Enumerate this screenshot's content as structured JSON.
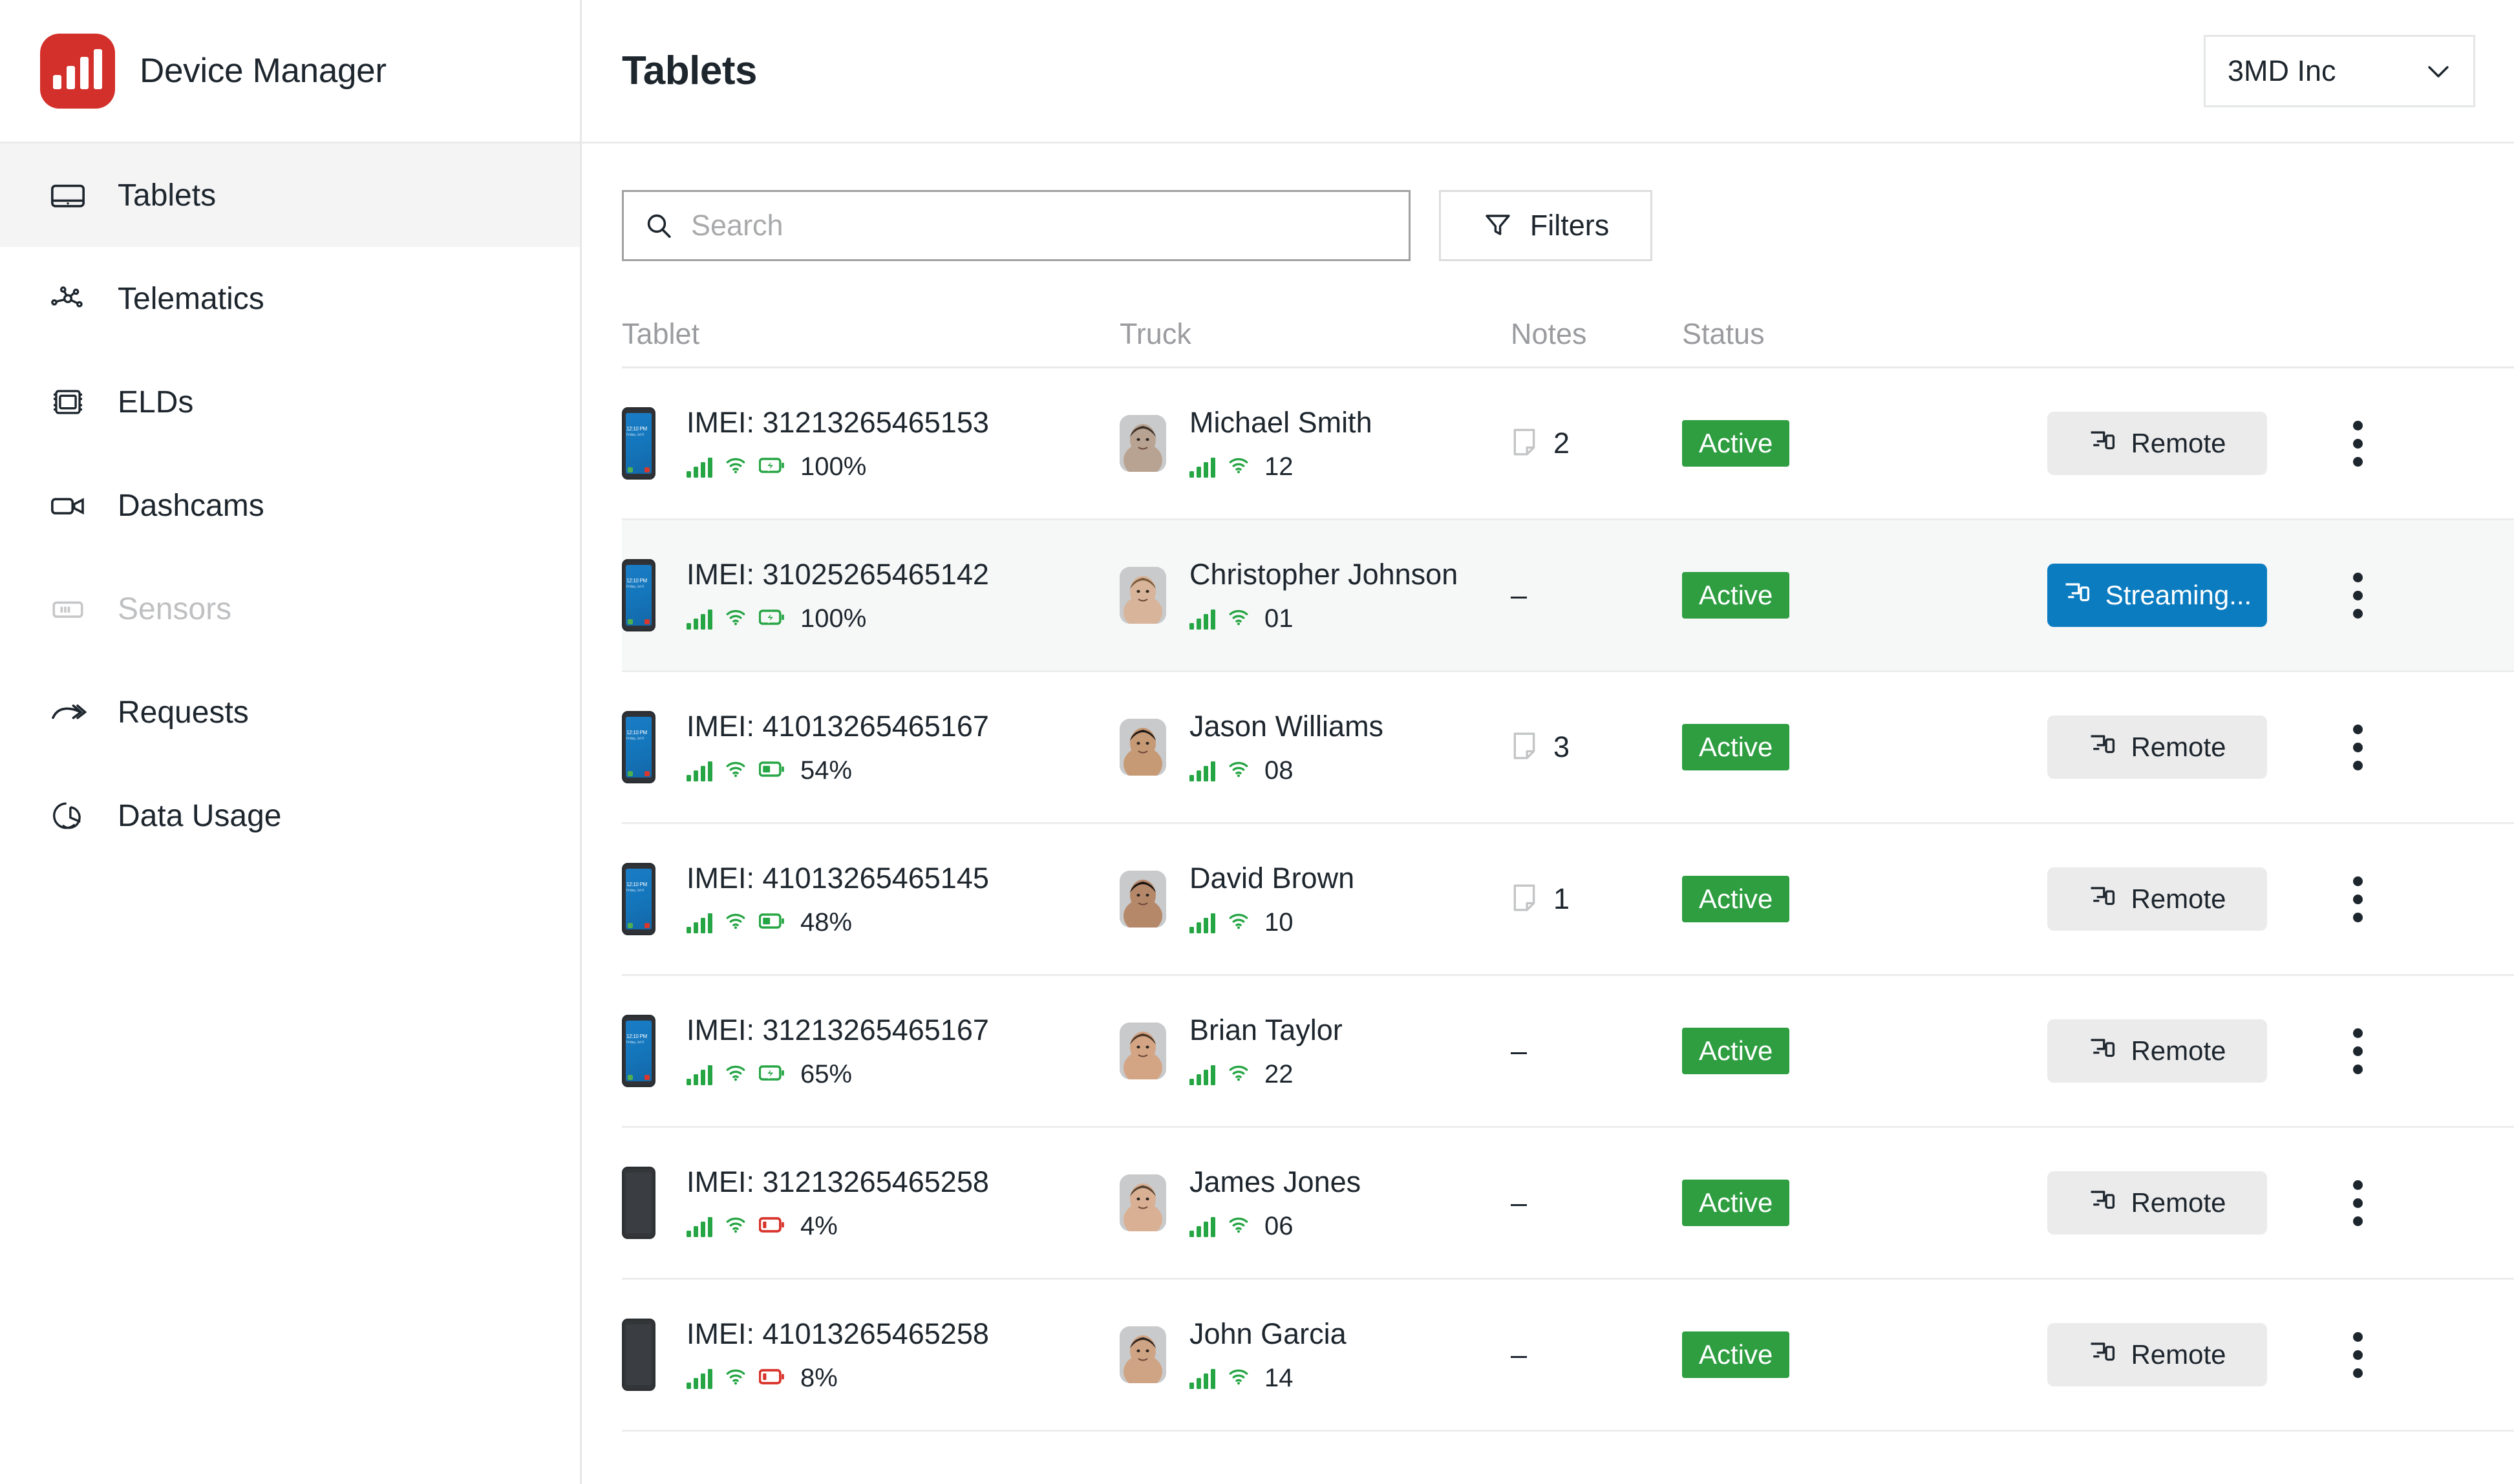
{
  "brand": {
    "name": "Device Manager",
    "logo_icon": "bar-chart-logo-icon",
    "logo_color": "#d32f2b"
  },
  "sidebar": {
    "items": [
      {
        "label": "Tablets",
        "icon": "tablet-icon",
        "active": true,
        "disabled": false
      },
      {
        "label": "Telematics",
        "icon": "telematics-icon",
        "active": false,
        "disabled": false
      },
      {
        "label": "ELDs",
        "icon": "eld-icon",
        "active": false,
        "disabled": false
      },
      {
        "label": "Dashcams",
        "icon": "dashcam-icon",
        "active": false,
        "disabled": false
      },
      {
        "label": "Sensors",
        "icon": "sensor-icon",
        "active": false,
        "disabled": true
      },
      {
        "label": "Requests",
        "icon": "requests-icon",
        "active": false,
        "disabled": false
      },
      {
        "label": "Data Usage",
        "icon": "data-usage-icon",
        "active": false,
        "disabled": false
      }
    ]
  },
  "header": {
    "title": "Tablets",
    "org_selector": {
      "value": "3MD Inc",
      "chevron_icon": "chevron-down-icon"
    }
  },
  "toolbar": {
    "search": {
      "placeholder": "Search",
      "value": "",
      "icon": "search-icon"
    },
    "filters": {
      "label": "Filters",
      "icon": "funnel-icon"
    }
  },
  "table": {
    "columns": [
      "Tablet",
      "Truck",
      "Notes",
      "Status"
    ],
    "rows": [
      {
        "imei": "IMEI: 31213265465153",
        "device_state": "on",
        "battery": "100%",
        "battery_icon": "battery-charging-icon",
        "battery_color": "#26a544",
        "driver": "Michael Smith",
        "truck_number": "12",
        "notes": "2",
        "has_notes": true,
        "status": "Active",
        "action": {
          "label": "Remote",
          "icon": "remote-screen-icon",
          "style": "default"
        },
        "highlight": false,
        "avatar_tone": "#b8a392",
        "avatar_hair": "#3b2f28"
      },
      {
        "imei": "IMEI: 31025265465142",
        "device_state": "on",
        "battery": "100%",
        "battery_icon": "battery-charging-icon",
        "battery_color": "#26a544",
        "driver": "Christopher Johnson",
        "truck_number": "01",
        "notes": "–",
        "has_notes": false,
        "status": "Active",
        "action": {
          "label": "Streaming...",
          "icon": "remote-screen-icon",
          "style": "streaming"
        },
        "highlight": true,
        "avatar_tone": "#d7b49a",
        "avatar_hair": "#7a5a3c"
      },
      {
        "imei": "IMEI: 41013265465167",
        "device_state": "on",
        "battery": "54%",
        "battery_icon": "battery-half-icon",
        "battery_color": "#26a544",
        "driver": "Jason Williams",
        "truck_number": "08",
        "notes": "3",
        "has_notes": true,
        "status": "Active",
        "action": {
          "label": "Remote",
          "icon": "remote-screen-icon",
          "style": "default"
        },
        "highlight": false,
        "avatar_tone": "#c79a76",
        "avatar_hair": "#221a15"
      },
      {
        "imei": "IMEI: 41013265465145",
        "device_state": "on",
        "battery": "48%",
        "battery_icon": "battery-half-icon",
        "battery_color": "#26a544",
        "driver": "David Brown",
        "truck_number": "10",
        "notes": "1",
        "has_notes": true,
        "status": "Active",
        "action": {
          "label": "Remote",
          "icon": "remote-screen-icon",
          "style": "default"
        },
        "highlight": false,
        "avatar_tone": "#b5886a",
        "avatar_hair": "#1b1512"
      },
      {
        "imei": "IMEI: 31213265465167",
        "device_state": "on",
        "battery": "65%",
        "battery_icon": "battery-charging-icon",
        "battery_color": "#26a544",
        "driver": "Brian Taylor",
        "truck_number": "22",
        "notes": "–",
        "has_notes": false,
        "status": "Active",
        "action": {
          "label": "Remote",
          "icon": "remote-screen-icon",
          "style": "default"
        },
        "highlight": false,
        "avatar_tone": "#d3a585",
        "avatar_hair": "#4a3526"
      },
      {
        "imei": "IMEI: 31213265465258",
        "device_state": "off",
        "battery": "4%",
        "battery_icon": "battery-low-icon",
        "battery_color": "#d8322a",
        "driver": "James Jones",
        "truck_number": "06",
        "notes": "–",
        "has_notes": false,
        "status": "Active",
        "action": {
          "label": "Remote",
          "icon": "remote-screen-icon",
          "style": "default"
        },
        "highlight": false,
        "avatar_tone": "#d9b094",
        "avatar_hair": "#53402f"
      },
      {
        "imei": "IMEI: 41013265465258",
        "device_state": "off",
        "battery": "8%",
        "battery_icon": "battery-low-icon",
        "battery_color": "#d8322a",
        "driver": "John Garcia",
        "truck_number": "14",
        "notes": "–",
        "has_notes": false,
        "status": "Active",
        "action": {
          "label": "Remote",
          "icon": "remote-screen-icon",
          "style": "default"
        },
        "highlight": false,
        "avatar_tone": "#cfa484",
        "avatar_hair": "#2e2620"
      }
    ]
  },
  "device_thumb": {
    "clock": "12:10 PM",
    "date": "Friday, Jul 9"
  },
  "colors": {
    "brand_red": "#d32f2b",
    "status_green": "#2e9e41",
    "streaming_blue": "#0c7cc0",
    "battery_red": "#d8322a",
    "signal_green": "#26a544",
    "text": "#1d252d",
    "muted": "#9b9c9f"
  }
}
